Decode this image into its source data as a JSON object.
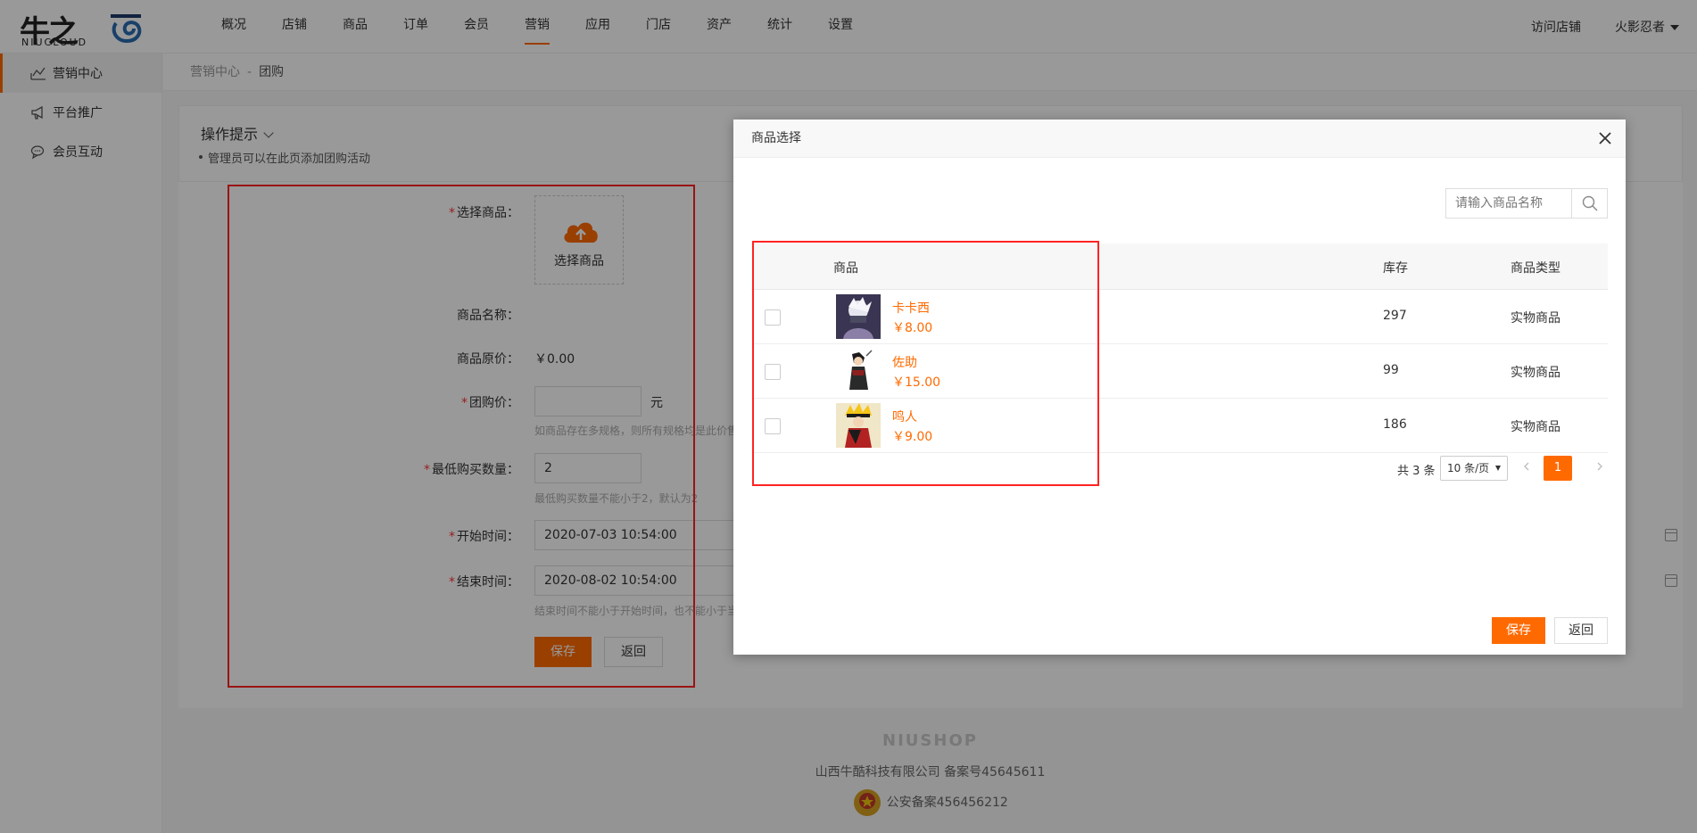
{
  "logo": {
    "cn": "牛之",
    "en": "NIUCLOUD"
  },
  "topnav": [
    "概况",
    "店铺",
    "商品",
    "订单",
    "会员",
    "营销",
    "应用",
    "门店",
    "资产",
    "统计",
    "设置"
  ],
  "header_right": {
    "visit": "访问店铺",
    "user": "火影忍者"
  },
  "sidebar": [
    {
      "label": "营销中心",
      "icon": "chart-icon"
    },
    {
      "label": "平台推广",
      "icon": "megaphone-icon"
    },
    {
      "label": "会员互动",
      "icon": "chat-icon"
    }
  ],
  "breadcrumb": {
    "parent": "营销中心",
    "sep": "-",
    "current": "团购"
  },
  "tips": {
    "title": "操作提示",
    "line": "管理员可以在此页添加团购活动"
  },
  "form": {
    "select_goods_label": "选择商品：",
    "select_goods_button": "选择商品",
    "goods_name_label": "商品名称：",
    "orig_price_label": "商品原价：",
    "orig_price_value": "￥0.00",
    "group_price_label": "团购价：",
    "group_price_unit": "元",
    "group_price_hint": "如商品存在多规格，则所有规格均是此价售卖，请谨慎设置",
    "min_buy_label": "最低购买数量：",
    "min_buy_value": "2",
    "min_buy_hint": "最低购买数量不能小于2，默认为2",
    "start_label": "开始时间：",
    "start_value": "2020-07-03 10:54:00",
    "end_label": "结束时间：",
    "end_value": "2020-08-02 10:54:00",
    "end_hint": "结束时间不能小于开始时间，也不能小于当前时间",
    "save": "保存",
    "back": "返回"
  },
  "footer": {
    "brand": "NIUSHOP",
    "company": "山西牛酷科技有限公司  备案号45645611",
    "police": "公安备案456456212"
  },
  "modal": {
    "title": "商品选择",
    "search_placeholder": "请输入商品名称",
    "columns": {
      "goods": "商品",
      "stock": "库存",
      "type": "商品类型"
    },
    "rows": [
      {
        "name": "卡卡西",
        "price": "￥8.00",
        "stock": "297",
        "type": "实物商品"
      },
      {
        "name": "佐助",
        "price": "￥15.00",
        "stock": "99",
        "type": "实物商品"
      },
      {
        "name": "鸣人",
        "price": "￥9.00",
        "stock": "186",
        "type": "实物商品"
      }
    ],
    "pager": {
      "total": "共 3 条",
      "size": "10 条/页",
      "page": "1"
    },
    "save": "保存",
    "back": "返回"
  },
  "colors": {
    "accent": "#ff6a00",
    "highlight_box": "#ff2222",
    "required": "#ff3333"
  }
}
